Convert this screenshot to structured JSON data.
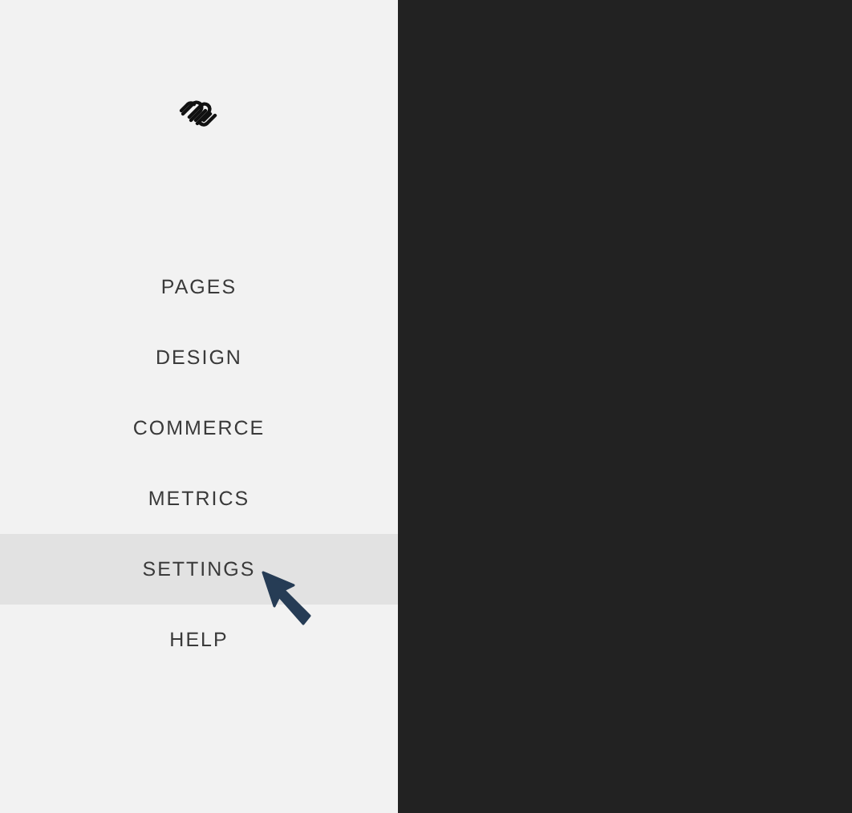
{
  "sidebar": {
    "items": [
      {
        "label": "PAGES",
        "selected": false
      },
      {
        "label": "DESIGN",
        "selected": false
      },
      {
        "label": "COMMERCE",
        "selected": false
      },
      {
        "label": "METRICS",
        "selected": false
      },
      {
        "label": "SETTINGS",
        "selected": true
      },
      {
        "label": "HELP",
        "selected": false
      }
    ]
  }
}
